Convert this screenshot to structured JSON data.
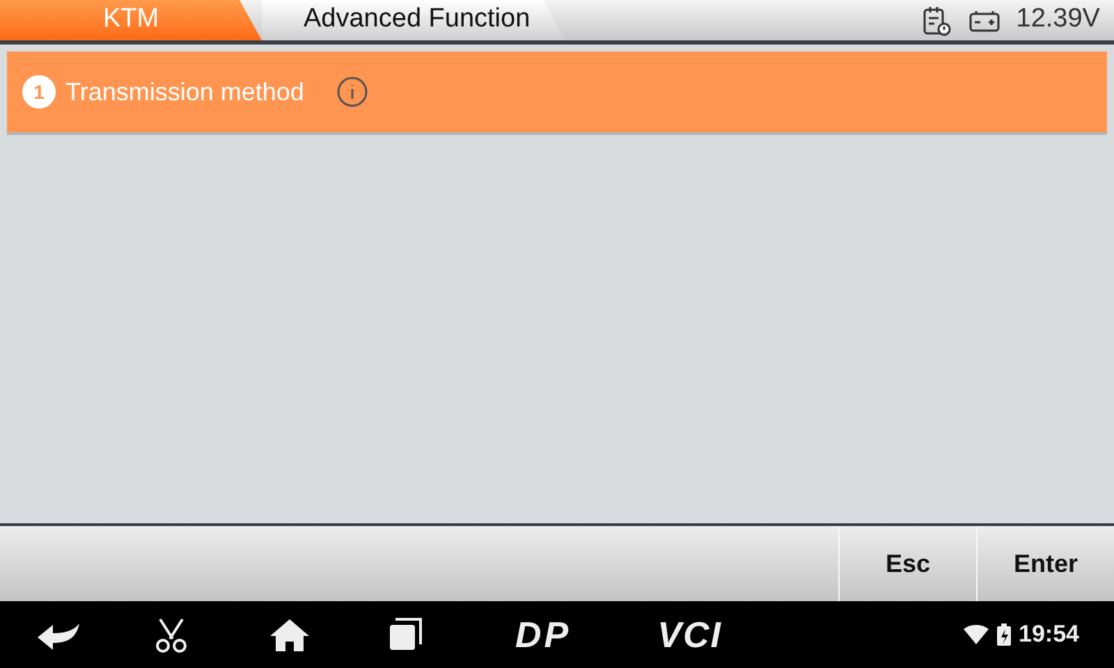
{
  "breadcrumbs": [
    {
      "label": "KTM",
      "selected": true
    },
    {
      "label": "Advanced Function",
      "selected": false
    }
  ],
  "status": {
    "voltage": "12.39V"
  },
  "items": [
    {
      "number": "1",
      "label": "Transmission method",
      "selected": true
    }
  ],
  "buttons": [
    "Esc",
    "Enter"
  ],
  "nav_bar": {
    "logos": [
      "DP",
      "VCI"
    ],
    "time": "19:54"
  }
}
